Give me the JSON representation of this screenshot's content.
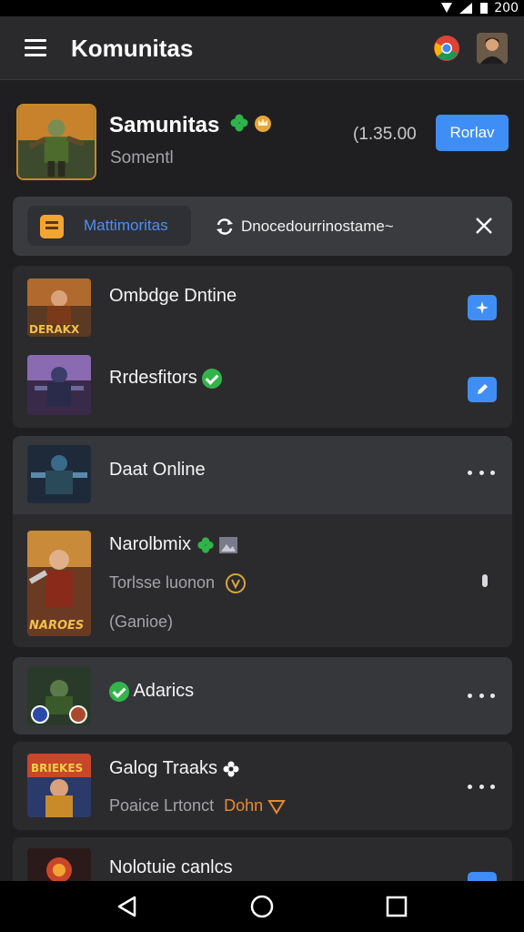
{
  "status": {
    "time": "200"
  },
  "appbar": {
    "title": "Komunitas",
    "menu_icon": "menu-icon",
    "browser_icon": "chrome-icon",
    "avatar": "avatar"
  },
  "header": {
    "title": "Samunitas",
    "subtitle": "Somentl",
    "count": "(1.35.00",
    "button_label": "Rorlav"
  },
  "notification": {
    "chip_label": "Mattimoritas",
    "text": "Dnocedourrinostame~",
    "close_icon": "close-icon"
  },
  "cards": [
    {
      "rows": [
        {
          "title": "Ombdge Dntine"
        },
        {
          "title": "Rrdesfitors"
        }
      ]
    },
    {
      "rows": [
        {
          "title": "Daat Online"
        },
        {
          "title": "Narolbmix",
          "subtitle": "Torlsse luonon",
          "subtitle2": "(Ganioe)"
        }
      ]
    },
    {
      "rows": [
        {
          "title": "Adarics"
        }
      ]
    },
    {
      "rows": [
        {
          "title": "Galog Traaks",
          "subtitle": "Poaice Lrtonct",
          "subtitle_accent": "Dohn"
        }
      ]
    },
    {
      "rows": [
        {
          "title": "Nolotuie canlcs"
        }
      ]
    }
  ],
  "thumb_labels": {
    "row1": "DERAKX",
    "row4": "NAROES",
    "row6": "BRIEKES"
  },
  "colors": {
    "accent_blue": "#3f8ef6",
    "accent_orange": "#f2a531",
    "green": "#33b44a",
    "background": "#1f1f21"
  }
}
